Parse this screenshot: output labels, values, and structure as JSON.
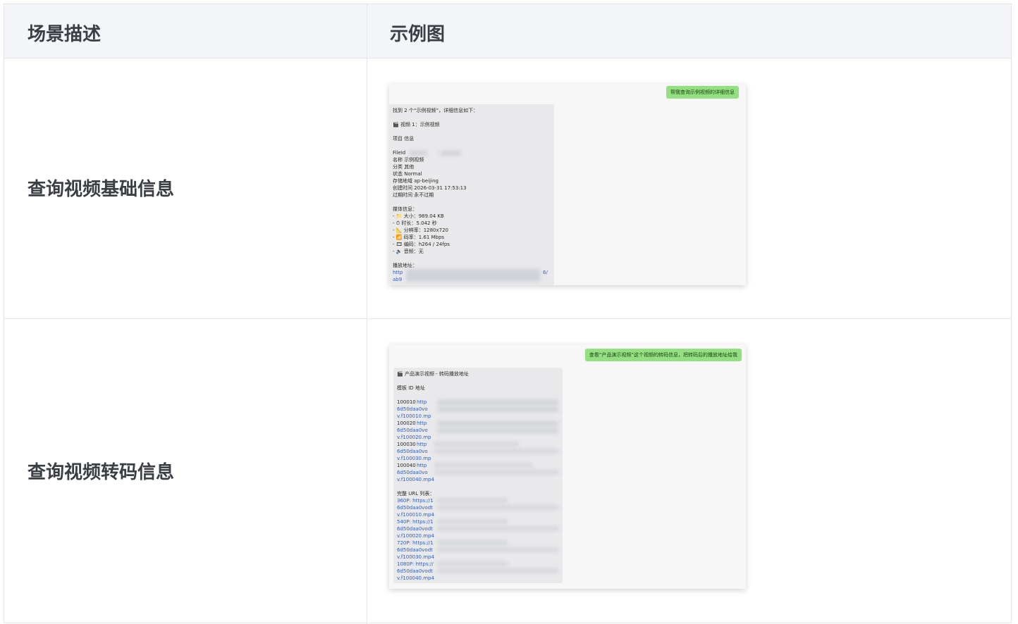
{
  "header": {
    "col1": "场景描述",
    "col2": "示例图"
  },
  "rows": [
    {
      "label": "查询视频基础信息",
      "user_message": "帮我查询示例视频的详细信息",
      "reply_lines": [
        "找到 2 个“示例视频”，详细信息如下：",
        "🎬 视频 1：示例视频",
        "项目  信息",
        "FileId",
        "名称  示例视频",
        "分类  其他",
        "状态  Normal",
        "存储地域  ap-beijing",
        "创建时间  2026-03-31 17:53:13",
        "过期时间  永不过期",
        "媒体信息：",
        "- 📁 大小：989.04 KB",
        "- ⏱ 时长：5.042 秒",
        "- 📐 分辨率：1280x720",
        "- 📶 码率：1.61 Mbps",
        "- 🎞 编码：h264 / 24fps",
        "- 🔈 音频：无",
        "播放地址：",
        "http",
        "ab9",
        "6/"
      ]
    },
    {
      "label": "查询视频转码信息",
      "user_message": "查看“产品演示视频”这个视频的转码信息，把转码后的播放地址给我",
      "reply_lines": [
        "🎬 产品演示视频 - 转码播放地址",
        "模板 ID  地址",
        "100010",
        "http",
        "6d50daa0vo",
        "v.f100010.mp",
        "100020",
        "http",
        "6d50daa0vo",
        "v.f100020.mp",
        "100030",
        "http",
        "6d50daa0vo",
        "v.f100030.mp",
        "100040",
        "http",
        "6d50daa0vo",
        "v.f100040.mp4",
        "完整 URL 列表：",
        "360P: https://1",
        "6d50daa0vodt",
        "v.f100010.mp4",
        "540P: https://1",
        "6d50daa0vodt",
        "v.f100020.mp4",
        "720P: https://1",
        "6d50daa0vodt",
        "v.f100030.mp4",
        "1080P: https://",
        "6d50daa0vodt",
        "v.f100040.mp4"
      ]
    }
  ]
}
